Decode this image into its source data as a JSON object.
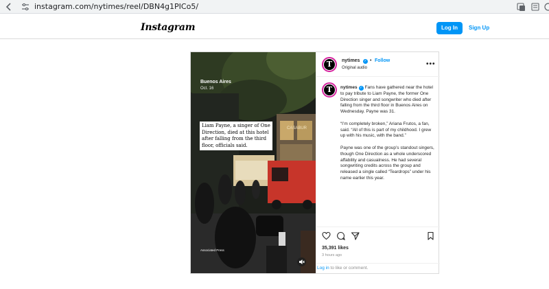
{
  "browser": {
    "url": "instagram.com/nytimes/reel/DBN4g1PICo5/",
    "icons": [
      "back-icon",
      "site-settings-icon",
      "translate-icon",
      "reader-mode-icon"
    ]
  },
  "header": {
    "logo": "Instagram",
    "login_label": "Log In",
    "signup_label": "Sign Up"
  },
  "post": {
    "account": "nytimes",
    "follow_label": "Follow",
    "separator": "•",
    "audio_label": "Original audio",
    "avatar_letter": "T",
    "media": {
      "location": "Buenos Aires",
      "date": "Oct. 16",
      "caption": "Liam Payne, a singer of One Direction, died at this hotel after falling from the third floor, officials said.",
      "credit": "Associated Press",
      "storefront_sign": "CASABUR"
    },
    "comment": {
      "username": "nytimes",
      "paragraph1": "Fans have gathered near the hotel to pay tribute to Liam Payne, the former One Direction singer and songwriter who died after falling from the third floor in Buenos Aires on Wednesday. Payne was 31.",
      "paragraph2": "“I’m completely broken,” Ariana Frutos, a fan, said. “All of this is part of my childhood. I grew up with his music, with the band.”",
      "paragraph3": "Payne was one of the group’s standout singers, though One Direction as a whole underscored affability and casualness. He had several songwriting credits across the group and released a single called “Teardrops” under his name earlier this year."
    },
    "likes": "35,391 likes",
    "time_ago": "3 hours ago",
    "login_link": "Log in",
    "login_suffix": " to like or comment.",
    "colors": {
      "accent": "#0095f6",
      "avatar_ring": "#d6249f",
      "text": "#262626",
      "muted": "#8e8e8e"
    }
  }
}
